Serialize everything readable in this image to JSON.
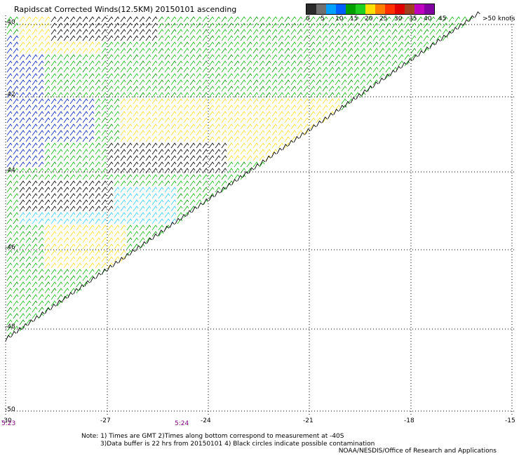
{
  "title": "Rapidscat Corrected Winds(12.5KM) 20150101 ascending",
  "legend": {
    "unit_label": ">50 knots",
    "labels": [
      "0",
      "5",
      "10",
      "15",
      "20",
      "25",
      "30",
      "35",
      "40",
      "45"
    ],
    "colors": [
      "#2a2a2a",
      "#707070",
      "#00a0ff",
      "#0060ff",
      "#00a000",
      "#20d020",
      "#ffe000",
      "#ff8000",
      "#ff3000",
      "#e00000",
      "#a04020",
      "#c000c0",
      "#8000a0"
    ]
  },
  "map": {
    "lon_ticks": [
      "-30",
      "-27",
      "-24",
      "-21",
      "-18",
      "-15"
    ],
    "lat_ticks": [
      "-40",
      "-42",
      "-44",
      "-46",
      "-48",
      "-50"
    ],
    "time_labels": [
      "5:23",
      "5:24"
    ]
  },
  "notes": {
    "line1": "Note: 1) Times are GMT 2)Times along bottom correspond to measurement at -40S",
    "line2": "3)Data buffer is 22 hrs from 20150101 4) Black circles indicate possible contamination",
    "credit": "NOAA/NESDIS/Office of Research and Applications"
  }
}
